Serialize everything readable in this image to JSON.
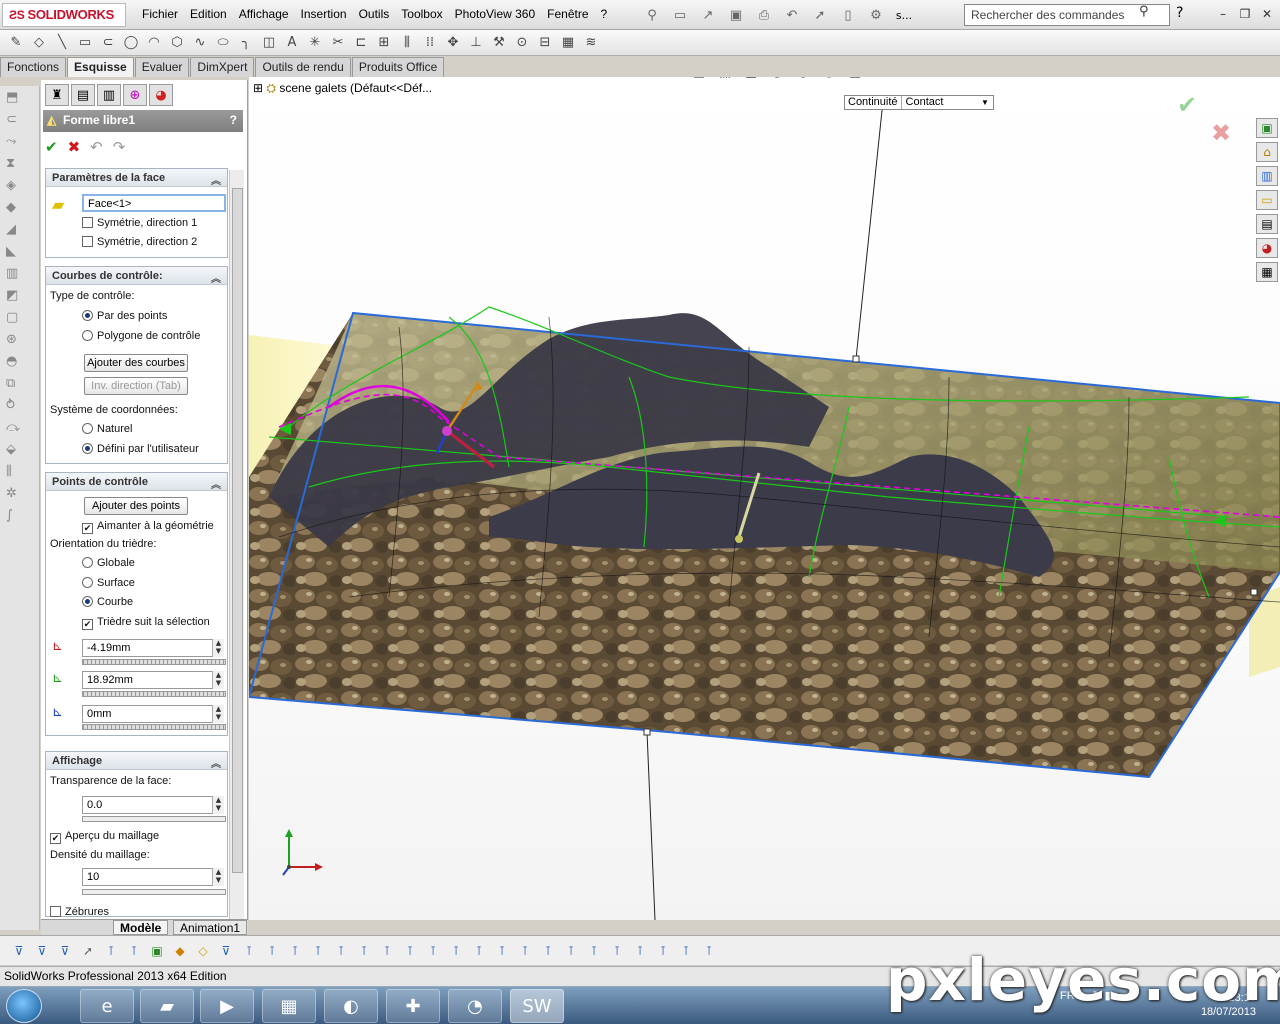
{
  "app": {
    "brand": "SOLIDWORKS",
    "menus": [
      "Fichier",
      "Edition",
      "Affichage",
      "Insertion",
      "Outils",
      "Toolbox",
      "PhotoView 360",
      "Fenêtre",
      "?"
    ],
    "search_placeholder": "Rechercher des commandes",
    "truncated_menu": "s..."
  },
  "command_tabs": [
    "Fonctions",
    "Esquisse",
    "Evaluer",
    "DimXpert",
    "Outils de rendu",
    "Produits Office"
  ],
  "active_command_tab": "Esquisse",
  "tree": {
    "root": "scene galets  (Défaut<<Déf..."
  },
  "feature": {
    "title": "Forme libre1",
    "help": "?"
  },
  "sections": {
    "face": {
      "title": "Paramètres de la face",
      "face_value": "Face<1>",
      "sym1": "Symétrie, direction 1",
      "sym2": "Symétrie, direction 2"
    },
    "curves": {
      "title": "Courbes de contrôle:",
      "type_label": "Type de contrôle:",
      "opt_points": "Par des points",
      "opt_polygon": "Polygone de contrôle",
      "btn_add_curves": "Ajouter des courbes",
      "btn_inv_direction": "Inv. direction (Tab)",
      "coord_label": "Système de coordonnées:",
      "opt_natural": "Naturel",
      "opt_user": "Défini par l'utilisateur"
    },
    "points": {
      "title": "Points de contrôle",
      "btn_add_points": "Ajouter des points",
      "snap": "Aimanter à la géométrie",
      "orientation_label": "Orientation du trièdre:",
      "opt_global": "Globale",
      "opt_surface": "Surface",
      "opt_curve": "Courbe",
      "follow": "Trièdre suit la sélection",
      "x_value": "-4.19mm",
      "y_value": "18.92mm",
      "z_value": "0mm"
    },
    "display": {
      "title": "Affichage",
      "transparency_label": "Transparence de la face:",
      "transparency_value": "0.0",
      "mesh_preview": "Aperçu du maillage",
      "density_label": "Densité du maillage:",
      "density_value": "10",
      "zebra": "Zébrures"
    }
  },
  "viewport": {
    "continuity_label": "Continuité",
    "continuity_value": "Contact"
  },
  "bottom_tabs": [
    "Modèle",
    "Animation1"
  ],
  "status": "SolidWorks Professional 2013 x64 Edition",
  "taskbar": {
    "lang": "FR",
    "time": "23:10",
    "date": "18/07/2013"
  },
  "watermark": "pxleyes.com",
  "colors": {
    "accent": "#c8102e",
    "edge": "#2a6ad8",
    "curve_green": "#19c819",
    "magenta": "#e000e0"
  }
}
